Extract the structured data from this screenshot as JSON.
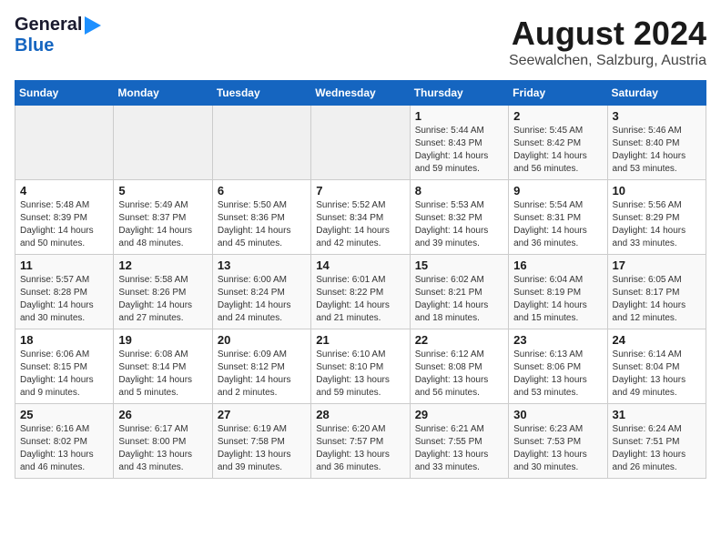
{
  "logo": {
    "general": "General",
    "blue": "Blue"
  },
  "title": "August 2024",
  "location": "Seewalchen, Salzburg, Austria",
  "days_of_week": [
    "Sunday",
    "Monday",
    "Tuesday",
    "Wednesday",
    "Thursday",
    "Friday",
    "Saturday"
  ],
  "weeks": [
    [
      {
        "num": "",
        "info": ""
      },
      {
        "num": "",
        "info": ""
      },
      {
        "num": "",
        "info": ""
      },
      {
        "num": "",
        "info": ""
      },
      {
        "num": "1",
        "info": "Sunrise: 5:44 AM\nSunset: 8:43 PM\nDaylight: 14 hours\nand 59 minutes."
      },
      {
        "num": "2",
        "info": "Sunrise: 5:45 AM\nSunset: 8:42 PM\nDaylight: 14 hours\nand 56 minutes."
      },
      {
        "num": "3",
        "info": "Sunrise: 5:46 AM\nSunset: 8:40 PM\nDaylight: 14 hours\nand 53 minutes."
      }
    ],
    [
      {
        "num": "4",
        "info": "Sunrise: 5:48 AM\nSunset: 8:39 PM\nDaylight: 14 hours\nand 50 minutes."
      },
      {
        "num": "5",
        "info": "Sunrise: 5:49 AM\nSunset: 8:37 PM\nDaylight: 14 hours\nand 48 minutes."
      },
      {
        "num": "6",
        "info": "Sunrise: 5:50 AM\nSunset: 8:36 PM\nDaylight: 14 hours\nand 45 minutes."
      },
      {
        "num": "7",
        "info": "Sunrise: 5:52 AM\nSunset: 8:34 PM\nDaylight: 14 hours\nand 42 minutes."
      },
      {
        "num": "8",
        "info": "Sunrise: 5:53 AM\nSunset: 8:32 PM\nDaylight: 14 hours\nand 39 minutes."
      },
      {
        "num": "9",
        "info": "Sunrise: 5:54 AM\nSunset: 8:31 PM\nDaylight: 14 hours\nand 36 minutes."
      },
      {
        "num": "10",
        "info": "Sunrise: 5:56 AM\nSunset: 8:29 PM\nDaylight: 14 hours\nand 33 minutes."
      }
    ],
    [
      {
        "num": "11",
        "info": "Sunrise: 5:57 AM\nSunset: 8:28 PM\nDaylight: 14 hours\nand 30 minutes."
      },
      {
        "num": "12",
        "info": "Sunrise: 5:58 AM\nSunset: 8:26 PM\nDaylight: 14 hours\nand 27 minutes."
      },
      {
        "num": "13",
        "info": "Sunrise: 6:00 AM\nSunset: 8:24 PM\nDaylight: 14 hours\nand 24 minutes."
      },
      {
        "num": "14",
        "info": "Sunrise: 6:01 AM\nSunset: 8:22 PM\nDaylight: 14 hours\nand 21 minutes."
      },
      {
        "num": "15",
        "info": "Sunrise: 6:02 AM\nSunset: 8:21 PM\nDaylight: 14 hours\nand 18 minutes."
      },
      {
        "num": "16",
        "info": "Sunrise: 6:04 AM\nSunset: 8:19 PM\nDaylight: 14 hours\nand 15 minutes."
      },
      {
        "num": "17",
        "info": "Sunrise: 6:05 AM\nSunset: 8:17 PM\nDaylight: 14 hours\nand 12 minutes."
      }
    ],
    [
      {
        "num": "18",
        "info": "Sunrise: 6:06 AM\nSunset: 8:15 PM\nDaylight: 14 hours\nand 9 minutes."
      },
      {
        "num": "19",
        "info": "Sunrise: 6:08 AM\nSunset: 8:14 PM\nDaylight: 14 hours\nand 5 minutes."
      },
      {
        "num": "20",
        "info": "Sunrise: 6:09 AM\nSunset: 8:12 PM\nDaylight: 14 hours\nand 2 minutes."
      },
      {
        "num": "21",
        "info": "Sunrise: 6:10 AM\nSunset: 8:10 PM\nDaylight: 13 hours\nand 59 minutes."
      },
      {
        "num": "22",
        "info": "Sunrise: 6:12 AM\nSunset: 8:08 PM\nDaylight: 13 hours\nand 56 minutes."
      },
      {
        "num": "23",
        "info": "Sunrise: 6:13 AM\nSunset: 8:06 PM\nDaylight: 13 hours\nand 53 minutes."
      },
      {
        "num": "24",
        "info": "Sunrise: 6:14 AM\nSunset: 8:04 PM\nDaylight: 13 hours\nand 49 minutes."
      }
    ],
    [
      {
        "num": "25",
        "info": "Sunrise: 6:16 AM\nSunset: 8:02 PM\nDaylight: 13 hours\nand 46 minutes."
      },
      {
        "num": "26",
        "info": "Sunrise: 6:17 AM\nSunset: 8:00 PM\nDaylight: 13 hours\nand 43 minutes."
      },
      {
        "num": "27",
        "info": "Sunrise: 6:19 AM\nSunset: 7:58 PM\nDaylight: 13 hours\nand 39 minutes."
      },
      {
        "num": "28",
        "info": "Sunrise: 6:20 AM\nSunset: 7:57 PM\nDaylight: 13 hours\nand 36 minutes."
      },
      {
        "num": "29",
        "info": "Sunrise: 6:21 AM\nSunset: 7:55 PM\nDaylight: 13 hours\nand 33 minutes."
      },
      {
        "num": "30",
        "info": "Sunrise: 6:23 AM\nSunset: 7:53 PM\nDaylight: 13 hours\nand 30 minutes."
      },
      {
        "num": "31",
        "info": "Sunrise: 6:24 AM\nSunset: 7:51 PM\nDaylight: 13 hours\nand 26 minutes."
      }
    ]
  ]
}
